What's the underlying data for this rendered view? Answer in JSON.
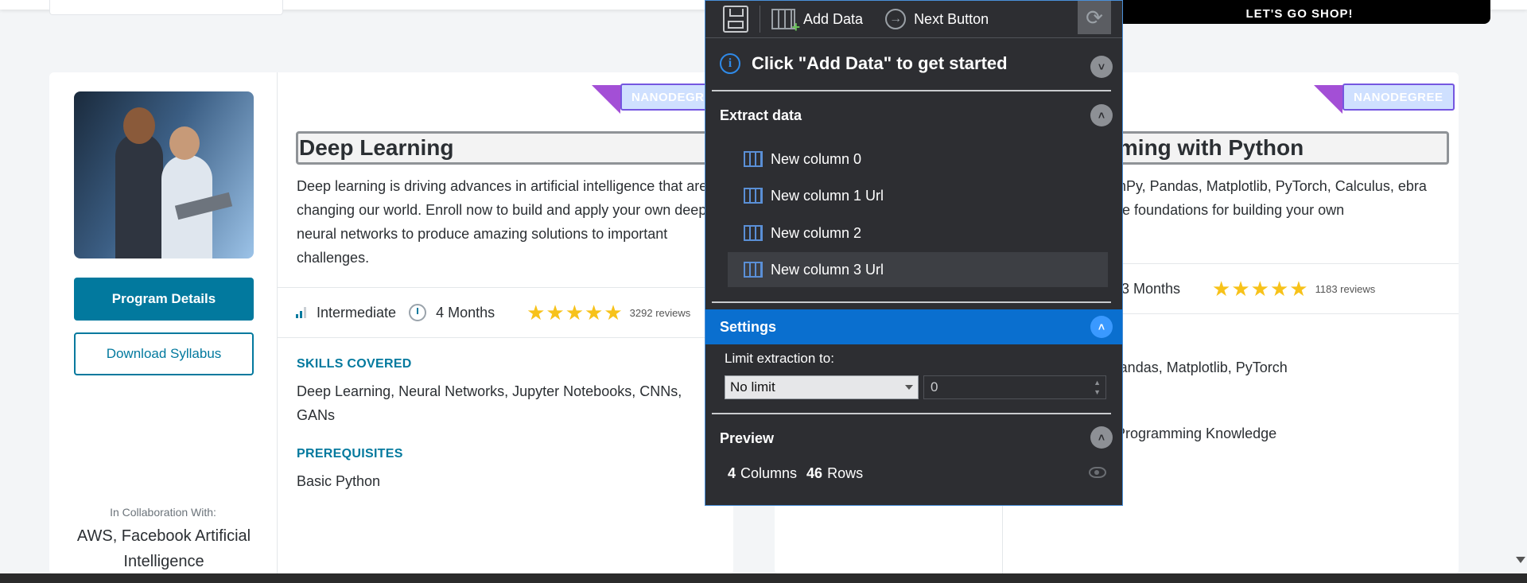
{
  "cards": [
    {
      "badge": "NANODEGREE",
      "title": "Deep Learning",
      "description": "Deep learning is driving advances in artificial intelligence that are changing our world. Enroll now to build and apply your own deep neural networks to produce amazing solutions to important challenges.",
      "level": "Intermediate",
      "duration": "4 Months",
      "reviews": "3292 reviews",
      "skills_label": "SKILLS COVERED",
      "skills": "Deep Learning, Neural Networks, Jupyter Notebooks, CNNs, GANs",
      "prereq_label": "PREREQUISITES",
      "prereq": "Basic Python",
      "program_details": "Program Details",
      "download_syllabus": "Download Syllabus",
      "collab_label": "In Collaboration With:",
      "collab_name": "AWS, Facebook Artificial Intelligence"
    },
    {
      "badge": "NANODEGREE",
      "title_partial": "mming with Python",
      "description_partial": "NumPy, Pandas, Matplotlib, PyTorch, Calculus, ebra—the foundations for building your own",
      "duration": "3 Months",
      "reviews": "1183 reviews",
      "skills_partial": "y, Pandas, Matplotlib, PyTorch",
      "prereq_partial": "nd Programming Knowledge"
    }
  ],
  "toast": "LET'S GO SHOP!",
  "panel": {
    "toolbar": {
      "add_data": "Add Data",
      "next_button": "Next Button"
    },
    "info": "Click \"Add Data\" to get started",
    "extract_title": "Extract data",
    "columns": [
      "New column 0",
      "New column 1 Url",
      "New column 2",
      "New column 3 Url"
    ],
    "settings_title": "Settings",
    "limit_label": "Limit extraction to:",
    "limit_select": "No limit",
    "limit_value": "0",
    "preview_title": "Preview",
    "preview_columns": "4",
    "preview_columns_label": "Columns",
    "preview_rows": "46",
    "preview_rows_label": "Rows"
  }
}
